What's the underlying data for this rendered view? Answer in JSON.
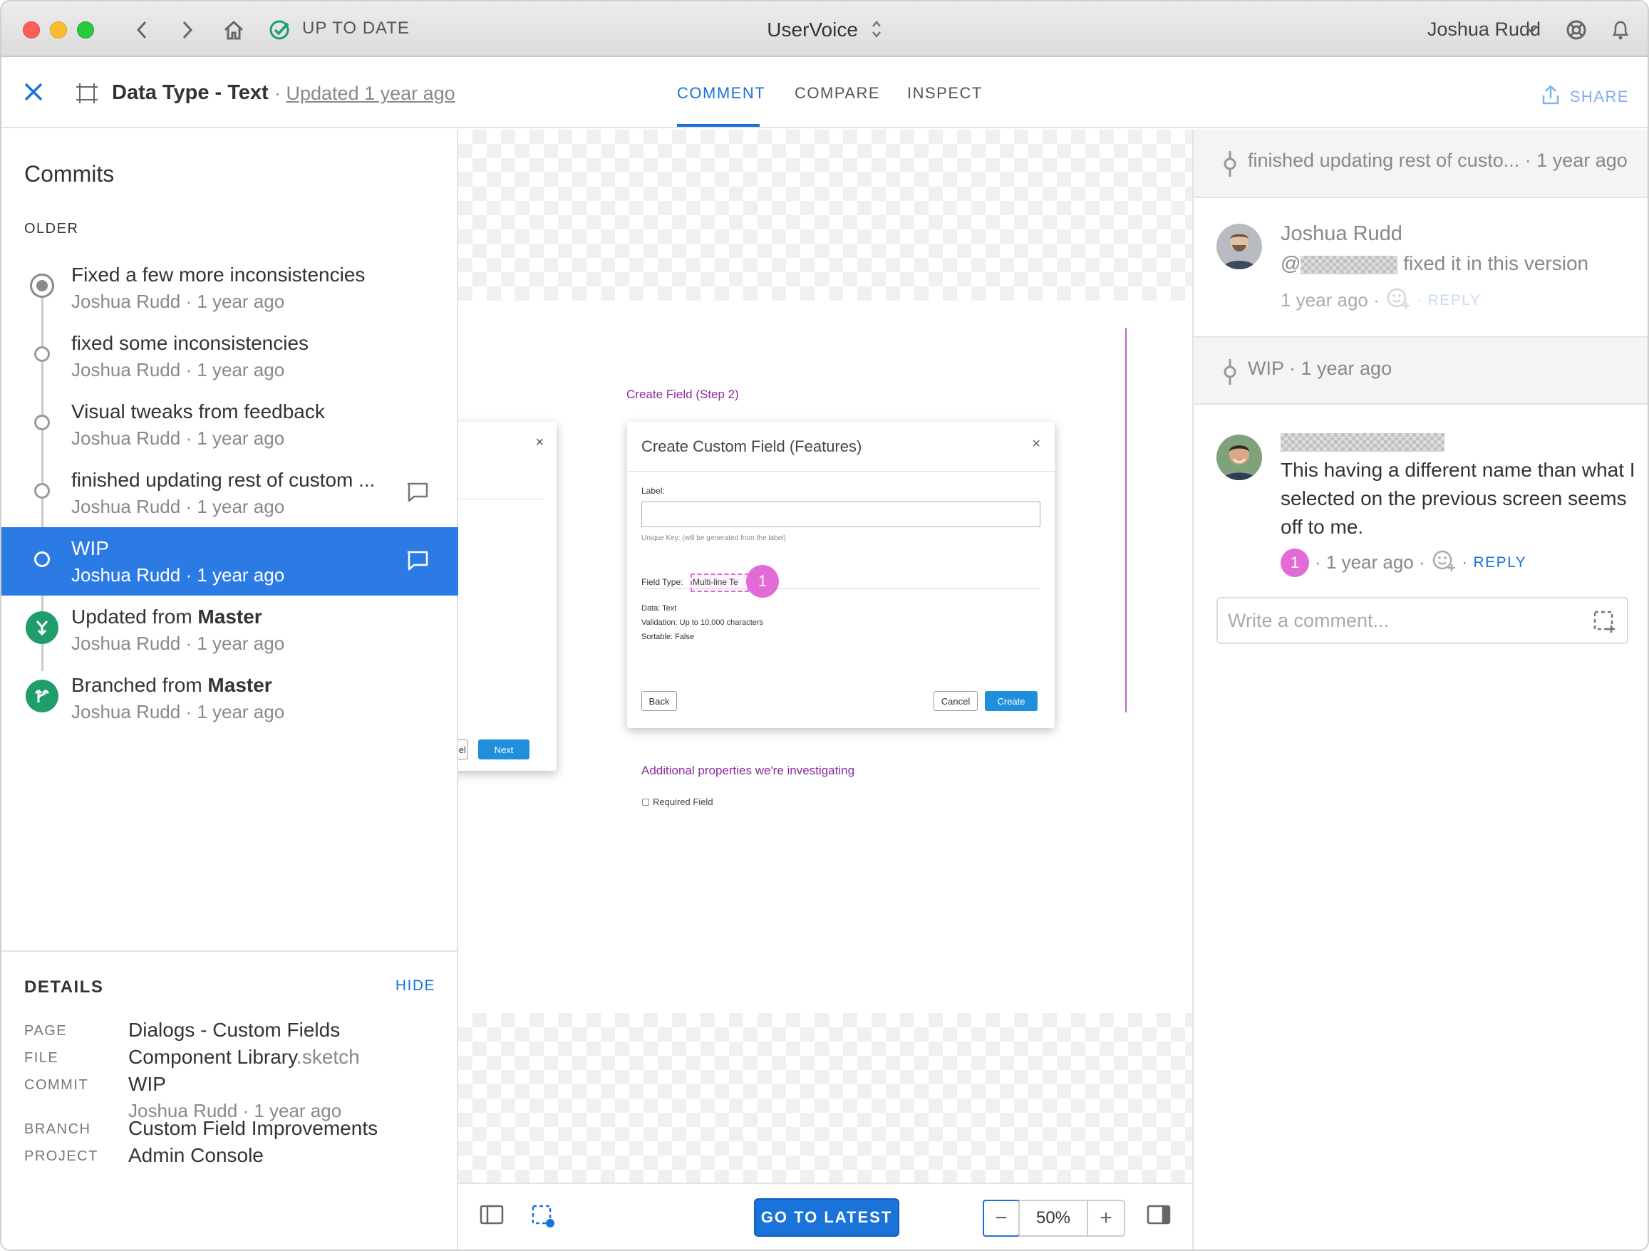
{
  "titlebar": {
    "status": "UP TO DATE",
    "app_title": "UserVoice",
    "user_name": "Joshua Rudd"
  },
  "header": {
    "title": "Data Type - Text",
    "updated_prefix": " · ",
    "updated_link": "Updated 1 year ago",
    "tabs": [
      {
        "label": "COMMENT",
        "active": true
      },
      {
        "label": "COMPARE",
        "active": false
      },
      {
        "label": "INSPECT",
        "active": false
      }
    ],
    "share_label": "SHARE"
  },
  "sidebar": {
    "title": "Commits",
    "section_label": "OLDER",
    "commits": [
      {
        "message": "Fixed a few more inconsistencies",
        "meta": "Joshua Rudd · 1 year ago",
        "node": "head",
        "has_comment": false,
        "selected": false
      },
      {
        "message": "fixed some inconsistencies",
        "meta": "Joshua Rudd · 1 year ago",
        "node": "normal",
        "has_comment": false,
        "selected": false
      },
      {
        "message": "Visual tweaks from feedback",
        "meta": "Joshua Rudd · 1 year ago",
        "node": "normal",
        "has_comment": false,
        "selected": false
      },
      {
        "message": "finished updating rest of custom ...",
        "meta": "Joshua Rudd · 1 year ago",
        "node": "normal",
        "has_comment": true,
        "selected": false
      },
      {
        "message": "WIP",
        "meta": "Joshua Rudd · 1 year ago",
        "node": "normal",
        "has_comment": true,
        "selected": true
      },
      {
        "message_prefix": "Updated from ",
        "message_bold": "Master",
        "meta": "Joshua Rudd · 1 year ago",
        "node": "merge",
        "has_comment": false,
        "selected": false
      },
      {
        "message_prefix": "Branched from ",
        "message_bold": "Master",
        "meta": "Joshua Rudd · 1 year ago",
        "node": "branch",
        "has_comment": false,
        "selected": false
      }
    ],
    "details": {
      "title": "DETAILS",
      "hide_label": "HIDE",
      "page_label": "PAGE",
      "page_value": "Dialogs - Custom Fields",
      "file_label": "FILE",
      "file_name": "Component Library",
      "file_ext": ".sketch",
      "commit_label": "COMMIT",
      "commit_value": "WIP",
      "commit_meta": "Joshua Rudd · 1 year ago",
      "branch_label": "BRANCH",
      "branch_value": "Custom Field Improvements",
      "project_label": "PROJECT",
      "project_value": "Admin Console"
    }
  },
  "canvas": {
    "step_label": "Create Field (Step 2)",
    "left_dialog": {
      "close": "×",
      "cancel_partial": "ncel",
      "next": "Next"
    },
    "dialog": {
      "title": "Create Custom Field (Features)",
      "close": "×",
      "label_label": "Label:",
      "unique_key_hint": "Unique Key: (will be generated from the label)",
      "field_type_label": "Field Type:",
      "field_type_value": "Multi-line Te",
      "data_label": "Data:",
      "data_value": "Text",
      "validation_label": "Validation:",
      "validation_value": "Up to 10,000 characters",
      "sortable_label": "Sortable:",
      "sortable_value": "False",
      "back": "Back",
      "cancel": "Cancel",
      "create": "Create"
    },
    "annotation_number": "1",
    "additional_props": "Additional properties we're investigating",
    "required_field": "Required Field"
  },
  "bottombar": {
    "go_latest": "GO TO LATEST",
    "zoom_minus": "−",
    "zoom_value": "50%",
    "zoom_plus": "+"
  },
  "rpanel": {
    "thread1": {
      "header": "finished updating rest of custo... · 1 year ago",
      "author": "Joshua Rudd",
      "text_at": "@",
      "text": " fixed it in this version",
      "time": "1 year ago ·",
      "reply": "· REPLY"
    },
    "thread2": {
      "header": "WIP · 1 year ago",
      "text": "This having a different name than what I selected on the previous screen seems off to me.",
      "pin": "1",
      "time": "· 1 year ago ·",
      "reply": "· REPLY"
    },
    "write_placeholder": "Write a comment..."
  },
  "colors": {
    "accent": "#1a73d9",
    "selected_row": "#2c7be5",
    "annotation": "#e36bd6",
    "artboard_purple": "#8a2b9c",
    "git_green": "#1f9d6b"
  }
}
